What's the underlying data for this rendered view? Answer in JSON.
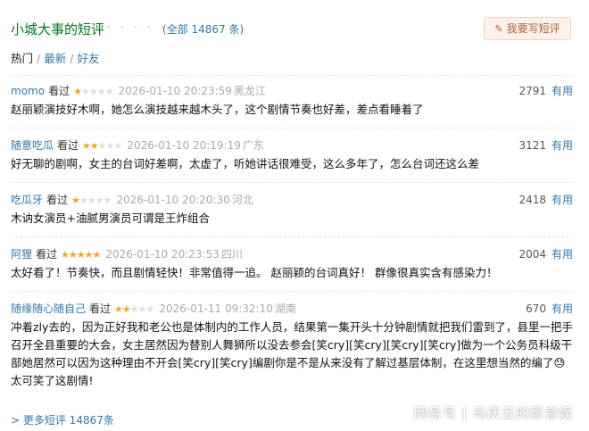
{
  "header": {
    "title": "小城大事的短评",
    "dots": "· · · · · ·",
    "count_open": "(",
    "count_label": "全部 14867 条",
    "count_close": ")",
    "write_button": "我要写短评"
  },
  "tabs": [
    {
      "label": "热门"
    },
    {
      "label": "最新"
    },
    {
      "label": "好友"
    }
  ],
  "tab_separator": "/",
  "comments": [
    {
      "user": "momo",
      "status": "看过",
      "rating": 1,
      "time": "2026-01-10 20:23:59",
      "location": "黑龙江",
      "votes": "2791",
      "useful": "有用",
      "text": "赵丽颖演技好木啊，她怎么演技越来越木头了，这个剧情节奏也好差，差点看睡着了"
    },
    {
      "user": "随意吃瓜",
      "status": "看过",
      "rating": 2,
      "time": "2026-01-10 20:19:19",
      "location": "广东",
      "votes": "3121",
      "useful": "有用",
      "text": "好无聊的剧啊，女主的台词好差啊，太虚了，听她讲话很难受，这么多年了，怎么台词还这么差"
    },
    {
      "user": "吃瓜牙",
      "status": "看过",
      "rating": 1,
      "time": "2026-01-10 20:20:30",
      "location": "河北",
      "votes": "2418",
      "useful": "有用",
      "text": "木讷女演员+油腻男演员可谓是王炸组合"
    },
    {
      "user": "阿狸",
      "status": "看过",
      "rating": 5,
      "time": "2026-01-10 20:23:53",
      "location": "四川",
      "votes": "2004",
      "useful": "有用",
      "text": "太好看了！节奏快，而且剧情轻快！非常值得一追。 赵丽颖的台词真好！ 群像很真实含有感染力！"
    },
    {
      "user": "随缘随心随自己",
      "status": "看过",
      "rating": 2,
      "time": "2026-01-11 09:32:10",
      "location": "湖南",
      "votes": "670",
      "useful": "有用",
      "text": "冲着zly去的，因为正好我和老公也是体制内的工作人员，结果第一集开头十分钟剧情就把我们雷到了，县里一把手召开全县重要的大会，女主居然因为替别人舞狮所以没去参会[笑cry][笑cry][笑cry][笑cry]做为一个公务员科级干部她居然可以因为这种理由不开会[笑cry][笑cry]编剧你是不是从来没有了解过基层体制，在这里想当然的编了😓太可笑了这剧情!"
    }
  ],
  "more_link": "> 更多短评 14867条",
  "watermark": {
    "left": "网易号",
    "right": "马庆云的影音娱"
  },
  "colors": {
    "accent": "#007722",
    "link": "#3377aa",
    "star": "#f5a623"
  }
}
